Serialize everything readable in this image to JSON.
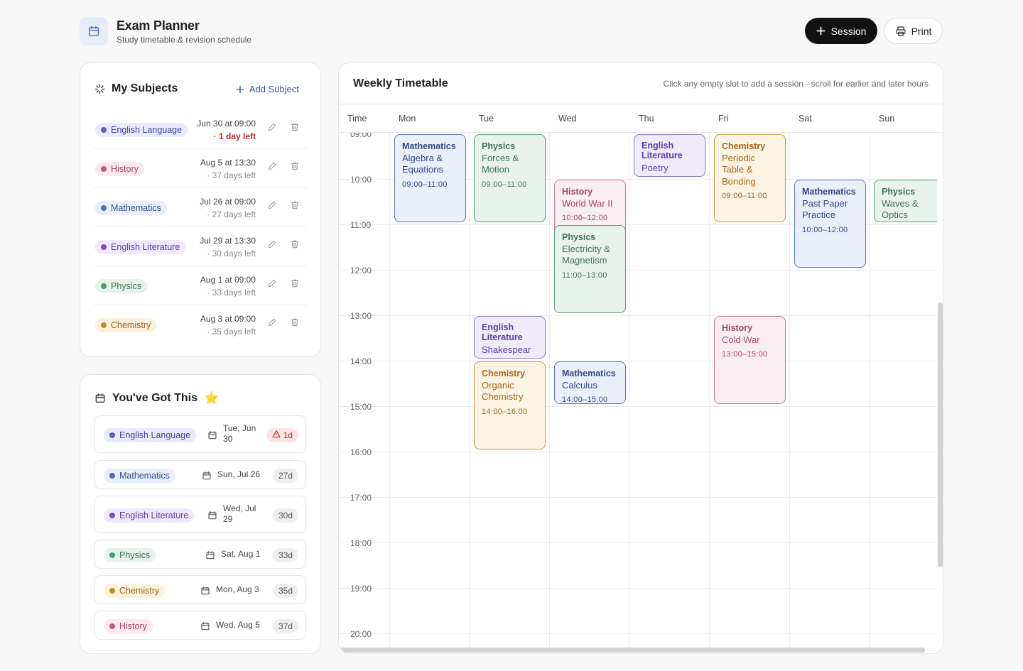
{
  "header": {
    "title": "Exam Planner",
    "subtitle": "Study timetable & revision schedule",
    "session_button": "Session",
    "print_button": "Print"
  },
  "colors": {
    "english_language": "#5a5fc7",
    "history": "#c4577a",
    "mathematics": "#4a6db5",
    "english_literature": "#7b4ec9",
    "physics": "#4f9a74",
    "chemistry": "#c08a2e",
    "urgent": "#c62828"
  },
  "subjects_panel": {
    "title": "My Subjects",
    "add_label": "Add Subject",
    "items": [
      {
        "name": "English Language",
        "date": "Jun 30 at 09:00",
        "left": "· 1 day left"
      },
      {
        "name": "History",
        "date": "Aug 5 at 13:30",
        "left": "· 37 days left"
      },
      {
        "name": "Mathematics",
        "date": "Jul 26 at 09:00",
        "left": "· 27 days left"
      },
      {
        "name": "English Literature",
        "date": "Jul 29 at 13:30",
        "left": "· 30 days left"
      },
      {
        "name": "Physics",
        "date": "Aug 1 at 09:00",
        "left": "· 33 days left"
      },
      {
        "name": "Chemistry",
        "date": "Aug 3 at 09:00",
        "left": "· 35 days left"
      }
    ]
  },
  "countdown_panel": {
    "title": "You've Got This",
    "title_emoji": "⭐",
    "items": [
      {
        "name": "English Language",
        "date_line1": "Tue, Jun",
        "date_line2": "30",
        "badge": "1d"
      },
      {
        "name": "Mathematics",
        "date_line1": "Sun, Jul 26",
        "date_line2": "",
        "badge": "27d"
      },
      {
        "name": "English Literature",
        "date_line1": "Wed, Jul",
        "date_line2": "29",
        "badge": "30d"
      },
      {
        "name": "Physics",
        "date_line1": "Sat, Aug 1",
        "date_line2": "",
        "badge": "33d"
      },
      {
        "name": "Chemistry",
        "date_line1": "Mon, Aug 3",
        "date_line2": "",
        "badge": "35d"
      },
      {
        "name": "History",
        "date_line1": "Wed, Aug 5",
        "date_line2": "",
        "badge": "37d"
      }
    ]
  },
  "timetable": {
    "title": "Weekly Timetable",
    "hint": "Click any empty slot to add a session · scroll for earlier and later hours",
    "time_header": "Time",
    "days": [
      "Mon",
      "Tue",
      "Wed",
      "Thu",
      "Fri",
      "Sat",
      "Sun"
    ],
    "hours": [
      "09:00",
      "10:00",
      "11:00",
      "12:00",
      "13:00",
      "14:00",
      "15:00",
      "16:00",
      "17:00",
      "18:00",
      "19:00",
      "20:00"
    ],
    "events": {
      "mon_math": {
        "subject": "Mathematics",
        "topic": "Algebra & Equations",
        "time": "09:00–11:00"
      },
      "tue_phys": {
        "subject": "Physics",
        "topic": "Forces & Motion",
        "time": "09:00–11:00"
      },
      "wed_hist": {
        "subject": "History",
        "topic": "World War II",
        "time": "10:00–12:00"
      },
      "wed_phys": {
        "subject": "Physics",
        "topic": "Electricity & Magnetism",
        "time": "11:00–13:00"
      },
      "thu_eng": {
        "subject": "English Literature",
        "topic": "Poetry",
        "time": ""
      },
      "fri_chem": {
        "subject": "Chemistry",
        "topic": "Periodic Table & Bonding",
        "time": "09:00–11:00"
      },
      "sat_math": {
        "subject": "Mathematics",
        "topic": "Past Paper Practice",
        "time": "10:00–12:00"
      },
      "sun_phys": {
        "subject": "Physics",
        "topic": "Waves & Optics",
        "time": ""
      },
      "tue_eng": {
        "subject": "English Literature",
        "topic": "Shakespear",
        "time": ""
      },
      "tue_chem": {
        "subject": "Chemistry",
        "topic": "Organic Chemistry",
        "time": "14:00–16:00"
      },
      "wed_math": {
        "subject": "Mathematics",
        "topic": "Calculus",
        "time": "14:00–15:00"
      },
      "fri_hist": {
        "subject": "History",
        "topic": "Cold War",
        "time": "13:00–15:00"
      }
    }
  }
}
